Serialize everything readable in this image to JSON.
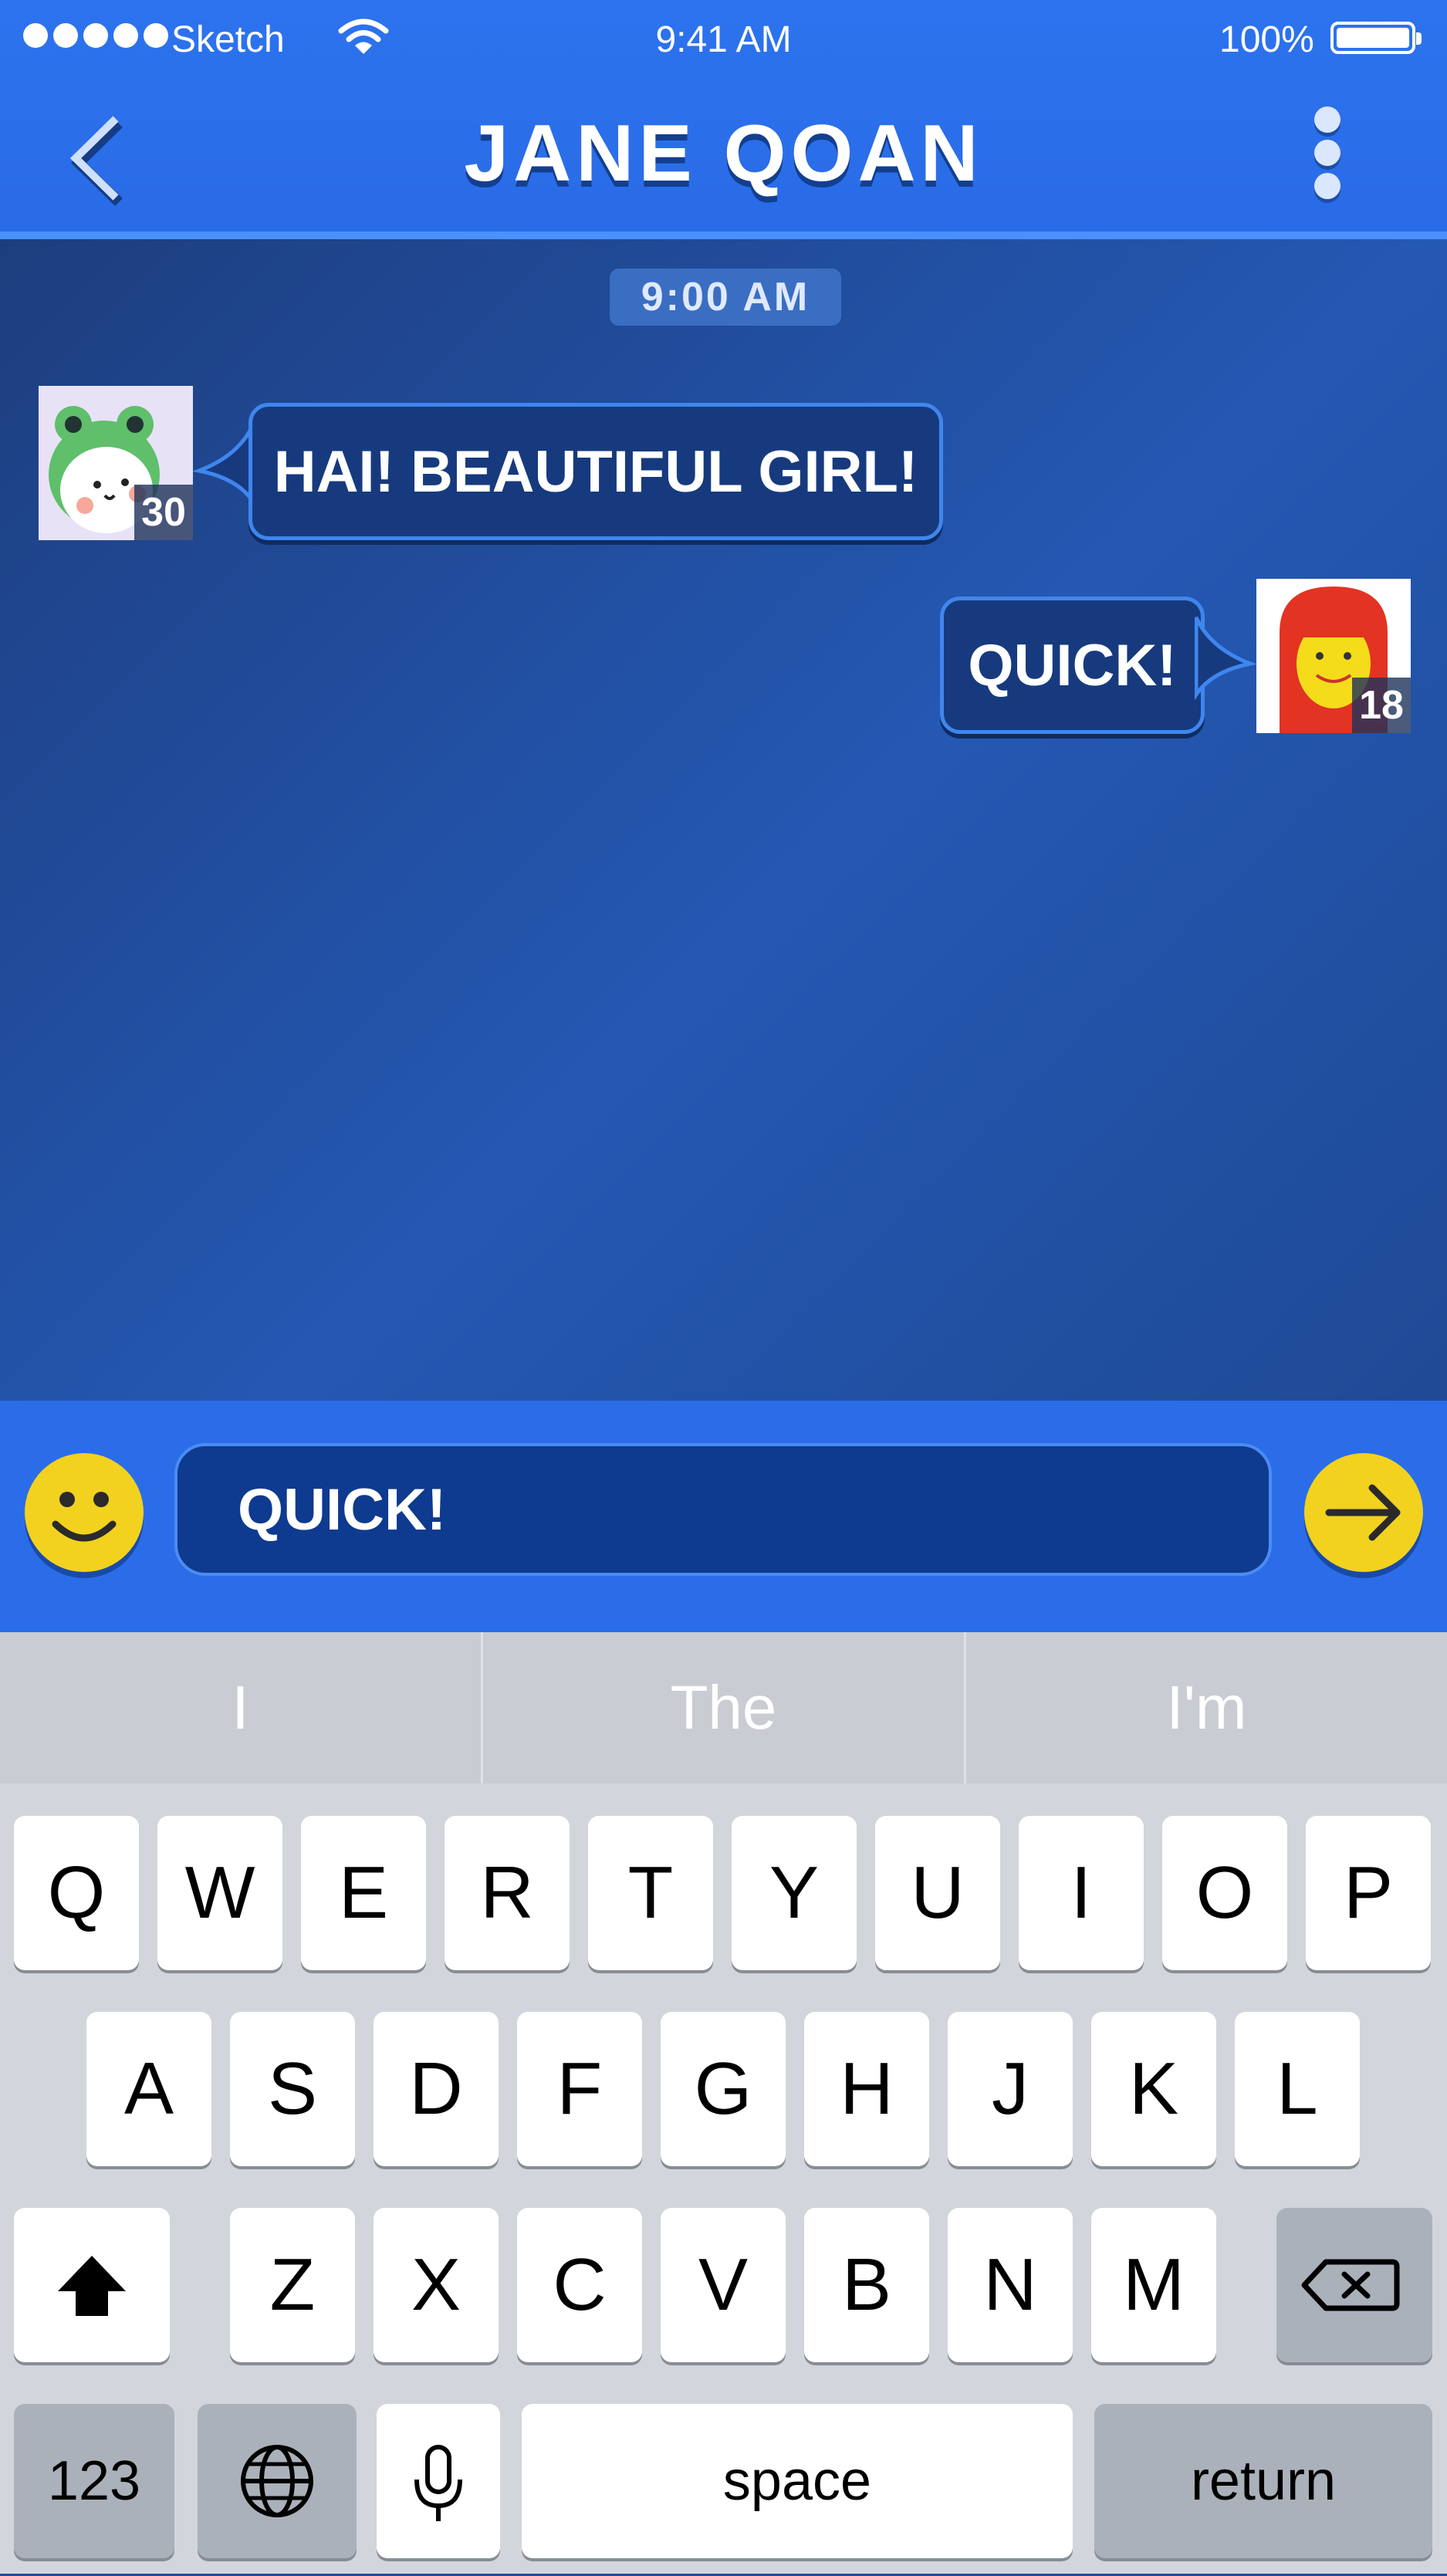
{
  "status_bar": {
    "carrier": "Sketch",
    "time": "9:41 AM",
    "battery": "100%"
  },
  "header": {
    "title": "JANE QOAN"
  },
  "chat": {
    "timestamp": "9:00 AM",
    "messages": [
      {
        "from": "other",
        "text": "HAI! BEAUTIFUL GIRL!",
        "age": "30"
      },
      {
        "from": "me",
        "text": "QUICK!",
        "age": "18"
      }
    ]
  },
  "composer": {
    "value": "QUICK!"
  },
  "keyboard": {
    "predictions": [
      "I",
      "The",
      "I'm"
    ],
    "row1": [
      "Q",
      "W",
      "E",
      "R",
      "T",
      "Y",
      "U",
      "I",
      "O",
      "P"
    ],
    "row2": [
      "A",
      "S",
      "D",
      "F",
      "G",
      "H",
      "J",
      "K",
      "L"
    ],
    "row3": [
      "Z",
      "X",
      "C",
      "V",
      "B",
      "N",
      "M"
    ],
    "numbers_label": "123",
    "space_label": "space",
    "return_label": "return"
  },
  "colors": {
    "header_blue": "#2d73ee",
    "chat_bg": "#1f4a94",
    "bubble": "#173a7e",
    "emoji_yellow": "#f2d21f"
  },
  "icons": [
    "back-chevron-icon",
    "more-dots-icon",
    "smiley-icon",
    "send-arrow-icon",
    "shift-icon",
    "backspace-icon",
    "globe-icon",
    "microphone-icon",
    "wifi-icon",
    "battery-icon"
  ]
}
